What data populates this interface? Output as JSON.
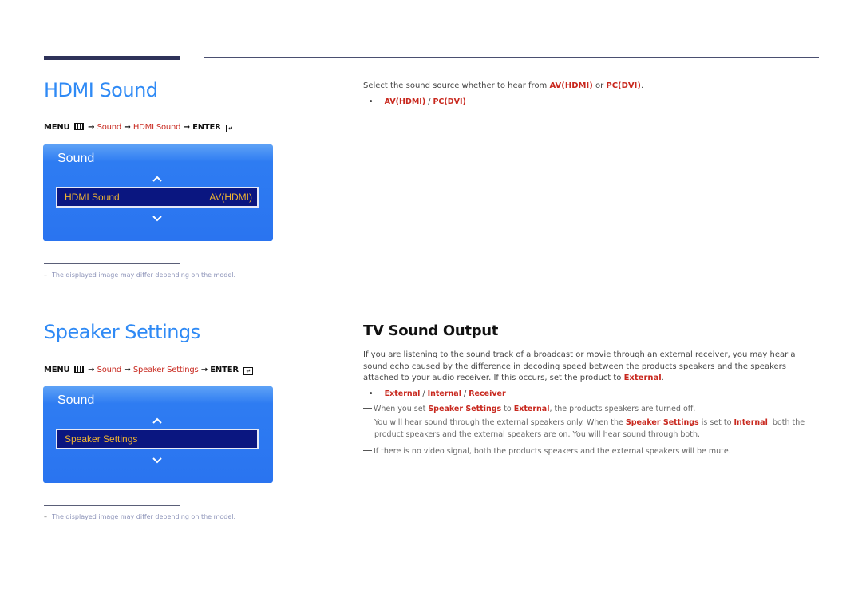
{
  "header": {
    "decor": "section-rule"
  },
  "hdmi_sound": {
    "title": "HDMI Sound",
    "path": {
      "menu": "MENU",
      "arrow": "→",
      "sound": "Sound",
      "item": "HDMI Sound",
      "enter": "ENTER"
    },
    "panel": {
      "title": "Sound",
      "selected_label": "HDMI Sound",
      "selected_value": "AV(HDMI)"
    },
    "footnote": "The displayed image may differ depending on the model.",
    "description_prefix": "Select the sound source whether to hear from ",
    "opt1": "AV(HDMI)",
    "or": " or ",
    "opt2": "PC(DVI)",
    "period": ".",
    "bullet": {
      "a": "AV(HDMI)",
      "sep": " / ",
      "b": "PC(DVI)"
    }
  },
  "speaker_settings": {
    "title": "Speaker Settings",
    "path": {
      "menu": "MENU",
      "arrow": "→",
      "sound": "Sound",
      "item": "Speaker Settings",
      "enter": "ENTER"
    },
    "panel": {
      "title": "Sound",
      "selected_label": "Speaker Settings"
    },
    "footnote": "The displayed image may differ depending on the model."
  },
  "tv_sound_output": {
    "title": "TV Sound Output",
    "para_prefix": "If you are listening to the sound track of a broadcast or movie through an external receiver, you may hear a sound echo caused by the difference in decoding speed between the products speakers and the speakers attached to your audio receiver. If this occurs, set the product to ",
    "para_emph": "External",
    "para_suffix": ".",
    "options": {
      "a": "External",
      "b": "Internal",
      "c": "Receiver",
      "sep": " / "
    },
    "note1": {
      "t1": "When you set ",
      "e1": "Speaker Settings",
      "t2": " to ",
      "e2": "External",
      "t3": ", the products speakers are turned off."
    },
    "note1b": {
      "t1": "You will hear sound through the external speakers only. When the ",
      "e1": "Speaker Settings",
      "t2": " is set to ",
      "e2": "Internal",
      "t3": ", both the product speakers and the external speakers are on. You will hear sound through both."
    },
    "note2": "If there is no video signal, both the products speakers and the external speakers will be mute."
  }
}
